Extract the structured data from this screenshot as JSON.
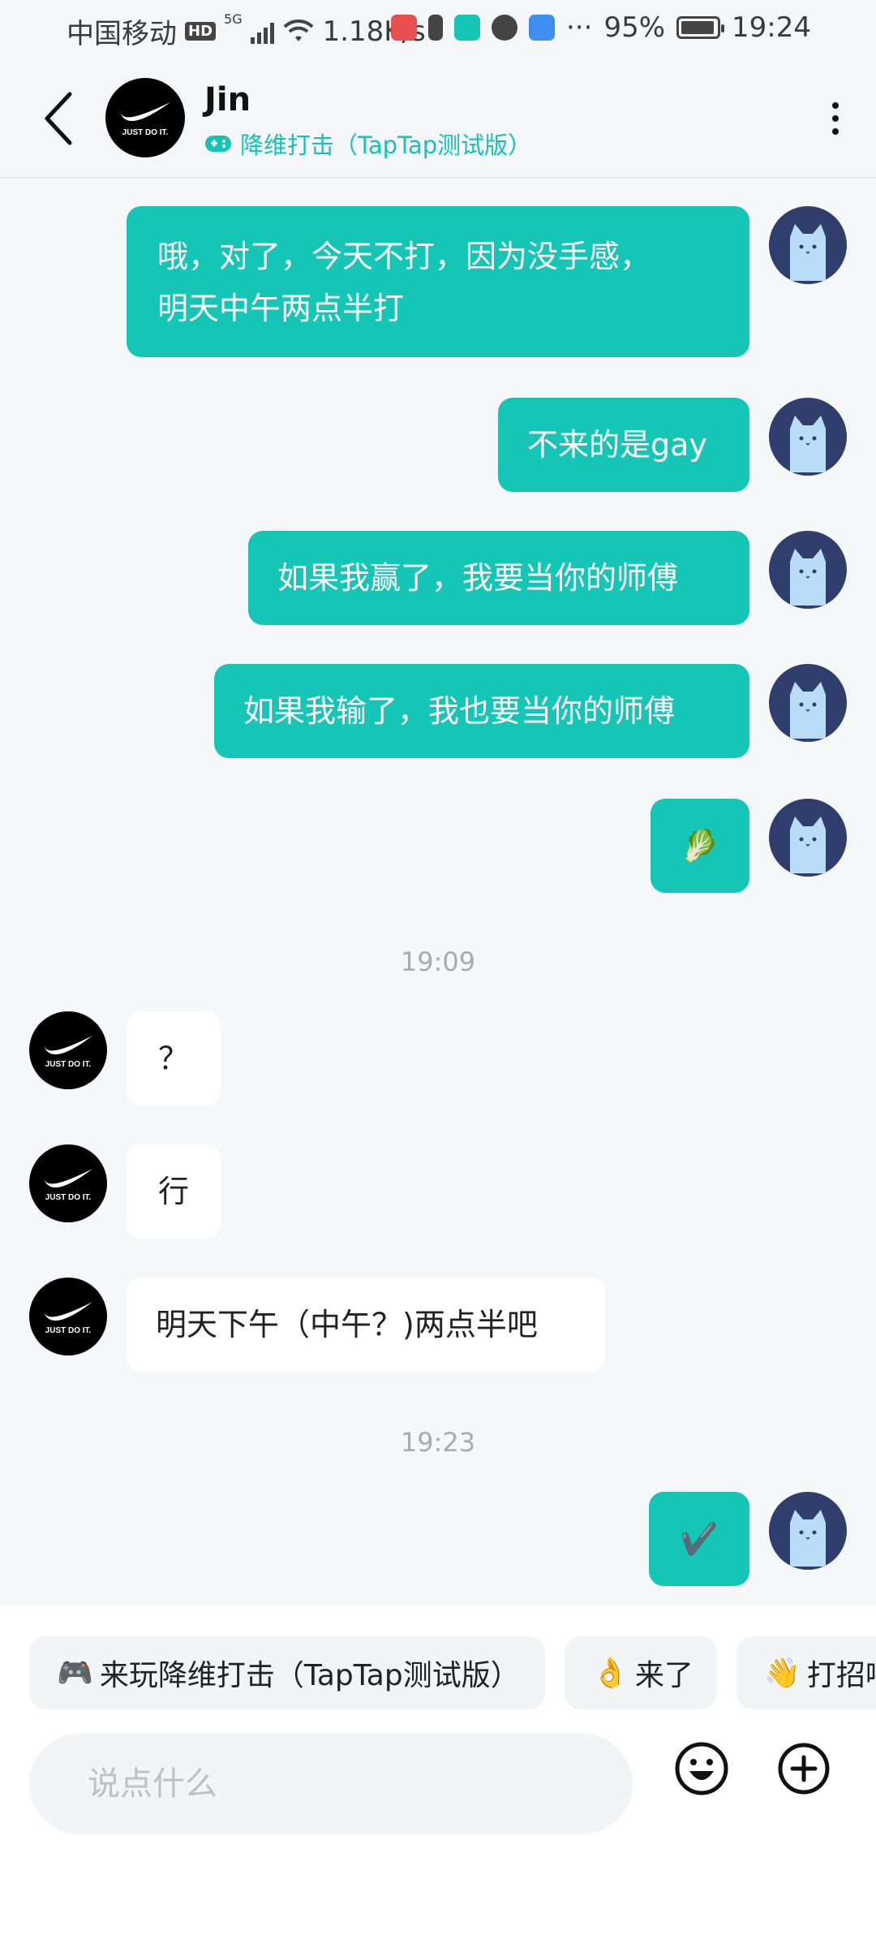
{
  "status_bar": {
    "carrier": "中国移动",
    "hd": "HD",
    "network": "5G",
    "speed": "1.18K/s",
    "more": "···",
    "battery": "95%",
    "battery_level": 0.95,
    "time": "19:24"
  },
  "header": {
    "name": "Jin",
    "game_label": "降维打击（TapTap测试版）",
    "avatar_text": "JUST DO IT."
  },
  "messages": [
    {
      "side": "out",
      "lines": [
        "哦，对了，今天不打，因为没手感，",
        "明天中午两点半打"
      ]
    },
    {
      "side": "out",
      "text": "不来的是gay"
    },
    {
      "side": "out",
      "text": "如果我赢了，我要当你的师傅"
    },
    {
      "side": "out",
      "text": "如果我输了，我也要当你的师傅"
    },
    {
      "side": "out",
      "text": "🥬"
    },
    {
      "timestamp": "19:09"
    },
    {
      "side": "in",
      "text": "？"
    },
    {
      "side": "in",
      "text": "行"
    },
    {
      "side": "in",
      "text": "明天下午（中午？)两点半吧"
    },
    {
      "timestamp": "19:23"
    },
    {
      "side": "out",
      "text": "✔️"
    }
  ],
  "quick_replies": [
    {
      "emoji": "🎮",
      "label": "来玩降维打击（TapTap测试版）"
    },
    {
      "emoji": "👌",
      "label": "来了"
    },
    {
      "emoji": "👋",
      "label": "打招呼"
    }
  ],
  "input": {
    "placeholder": "说点什么"
  },
  "colors": {
    "accent": "#15c5b6",
    "chat_bg": "#f5f7f9"
  }
}
